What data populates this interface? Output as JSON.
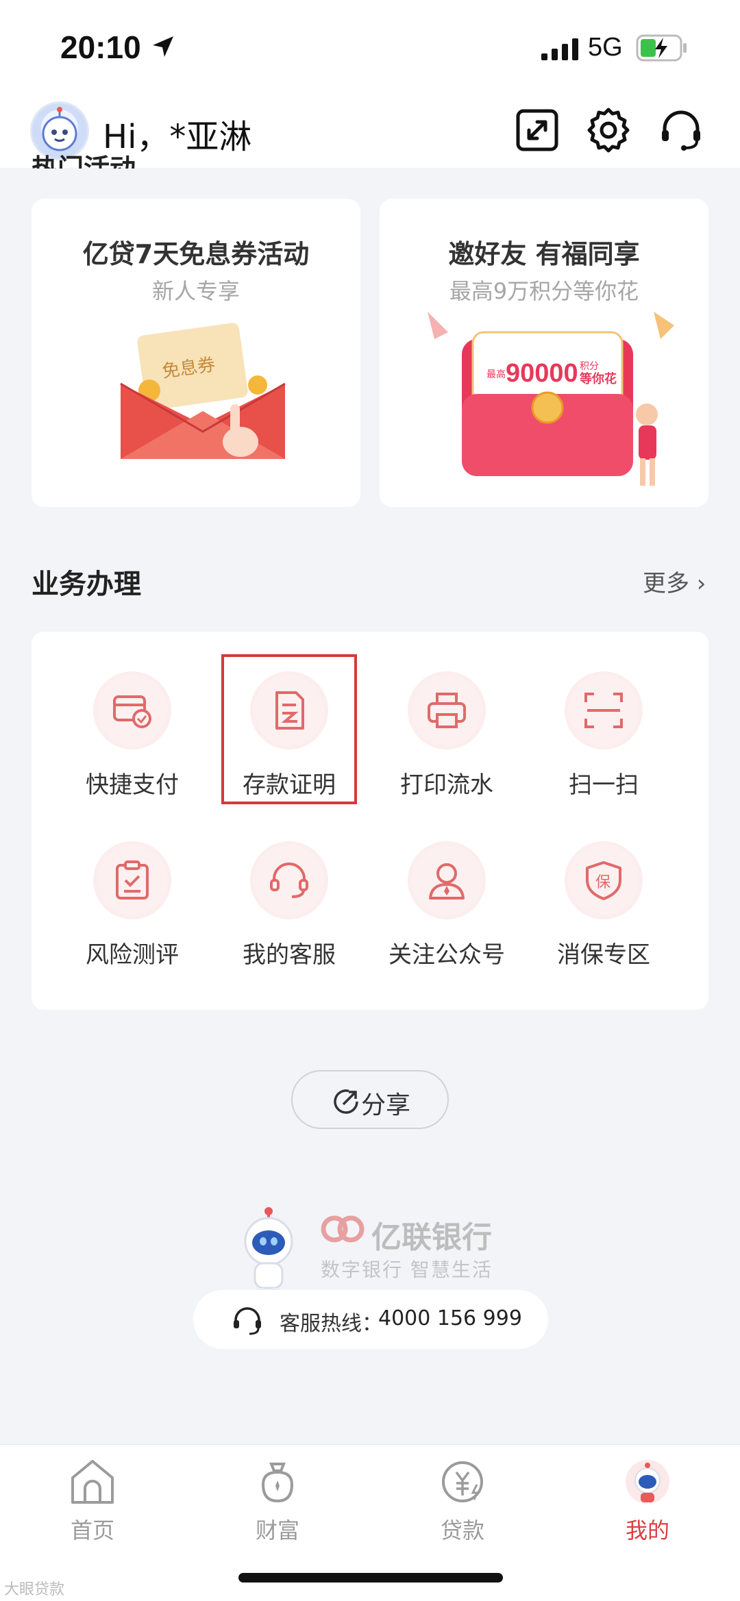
{
  "status_bar": {
    "time": "20:10",
    "network": "5G"
  },
  "header": {
    "greeting": "Hi，*亚淋"
  },
  "hot_section": {
    "title": "热门活动"
  },
  "promos": [
    {
      "title": "亿贷7天免息券活动",
      "subtitle": "新人专享",
      "badge": "免息券"
    },
    {
      "title": "邀好友 有福同享",
      "subtitle": "最高9万积分等你花",
      "highlight_number": "90000",
      "highlight_unit": "积分",
      "highlight_tail": "等你花",
      "highlight_prefix": "最高"
    }
  ],
  "business": {
    "title": "业务办理",
    "more": "更多 ›",
    "items": [
      {
        "label": "快捷支付",
        "icon": "card-check-icon"
      },
      {
        "label": "存款证明",
        "icon": "document-icon"
      },
      {
        "label": "打印流水",
        "icon": "printer-icon"
      },
      {
        "label": "扫一扫",
        "icon": "scan-icon"
      },
      {
        "label": "风险测评",
        "icon": "clipboard-check-icon"
      },
      {
        "label": "我的客服",
        "icon": "headset-icon"
      },
      {
        "label": "关注公众号",
        "icon": "person-icon"
      },
      {
        "label": "消保专区",
        "icon": "shield-icon"
      }
    ]
  },
  "share": {
    "label": "分享"
  },
  "brand": {
    "name": "亿联银行",
    "slogan": "数字银行 智慧生活"
  },
  "hotline": {
    "label": "客服热线：",
    "number": "4000 156 999"
  },
  "tabbar": {
    "tabs": [
      {
        "label": "首页",
        "icon": "home-icon",
        "active": false
      },
      {
        "label": "财富",
        "icon": "wealth-icon",
        "active": false
      },
      {
        "label": "贷款",
        "icon": "loan-icon",
        "active": false
      },
      {
        "label": "我的",
        "icon": "profile-avatar-icon",
        "active": true
      }
    ]
  },
  "watermark": "大眼贷款",
  "colors": {
    "accent": "#d94040",
    "highlight_border": "#d13a3a",
    "icon_stroke": "#e06a6a"
  }
}
